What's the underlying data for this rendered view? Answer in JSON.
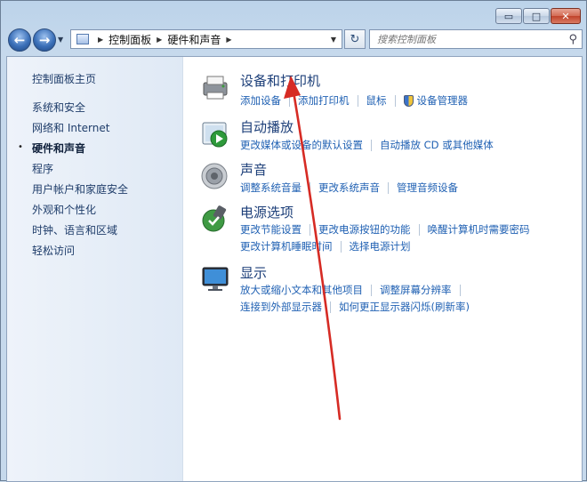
{
  "window": {
    "caption_buttons": {
      "minimize": "▭",
      "maximize": "□",
      "close": "✕"
    }
  },
  "nav": {
    "back_symbol": "←",
    "forward_symbol": "→",
    "history_dropdown": "▼",
    "breadcrumb": [
      "控制面板",
      "硬件和声音"
    ],
    "breadcrumb_sep": "▶",
    "address_dropdown": "▼",
    "refresh_symbol": "↻",
    "search_placeholder": "搜索控制面板",
    "search_icon": "magnifier-icon"
  },
  "sidebar": {
    "items": [
      {
        "label": "控制面板主页"
      },
      {
        "label": "系统和安全"
      },
      {
        "label": "网络和 Internet"
      },
      {
        "label": "硬件和声音",
        "current": true
      },
      {
        "label": "程序"
      },
      {
        "label": "用户帐户和家庭安全"
      },
      {
        "label": "外观和个性化"
      },
      {
        "label": "时钟、语言和区域"
      },
      {
        "label": "轻松访问"
      }
    ],
    "current_bullet": "•"
  },
  "categories": [
    {
      "title": "设备和打印机",
      "icon": "printer-icon",
      "rows": [
        [
          "添加设备",
          "添加打印机",
          "鼠标",
          "设备管理器"
        ]
      ]
    },
    {
      "title": "自动播放",
      "icon": "autoplay-icon",
      "rows": [
        [
          "更改媒体或设备的默认设置",
          "自动播放 CD 或其他媒体"
        ]
      ]
    },
    {
      "title": "声音",
      "icon": "speaker-icon",
      "rows": [
        [
          "调整系统音量",
          "更改系统声音",
          "管理音频设备"
        ]
      ]
    },
    {
      "title": "电源选项",
      "icon": "power-icon",
      "rows": [
        [
          "更改节能设置",
          "更改电源按钮的功能",
          "唤醒计算机时需要密码"
        ],
        [
          "更改计算机睡眠时间",
          "选择电源计划"
        ]
      ]
    },
    {
      "title": "显示",
      "icon": "display-icon",
      "rows": [
        [
          "放大或缩小文本和其他项目",
          "调整屏幕分辨率"
        ],
        [
          "连接到外部显示器",
          "如何更正显示器闪烁(刷新率)"
        ]
      ]
    }
  ],
  "colors": {
    "link": "#2061b3",
    "title": "#1d3f79",
    "annotation_arrow": "#d62b24"
  }
}
